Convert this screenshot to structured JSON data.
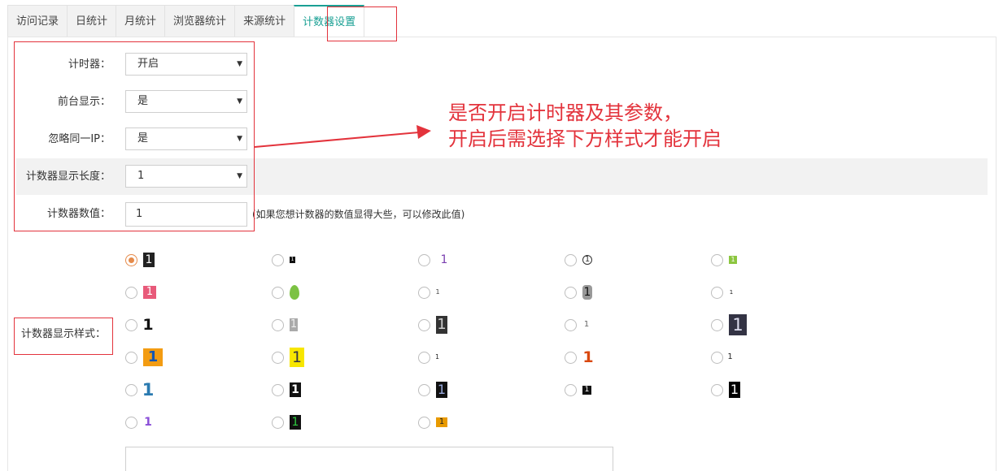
{
  "tabs": [
    {
      "label": "访问记录",
      "active": false
    },
    {
      "label": "日统计",
      "active": false
    },
    {
      "label": "月统计",
      "active": false
    },
    {
      "label": "浏览器统计",
      "active": false
    },
    {
      "label": "来源统计",
      "active": false
    },
    {
      "label": "计数器设置",
      "active": true
    }
  ],
  "form": {
    "timer": {
      "label": "计时器：",
      "value": "开启"
    },
    "front_display": {
      "label": "前台显示：",
      "value": "是"
    },
    "ignore_ip": {
      "label": "忽略同一IP：",
      "value": "是"
    },
    "display_length": {
      "label": "计数器显示长度：",
      "value": "1"
    },
    "counter_value": {
      "label": "计数器数值：",
      "value": "1",
      "hint": "(如果您想计数器的数值显得大些，可以修改此值)"
    },
    "style_label": "计数器显示样式："
  },
  "annotation": {
    "line1": "是否开启计时器及其参数，",
    "line2": "开启后需选择下方样式才能开启"
  },
  "styles": {
    "selected_index": 0,
    "count": 28,
    "glyph": "1"
  },
  "colors": {
    "accent": "#1aa094",
    "annotation": "#e3333c",
    "radio_checked": "#e58a4a"
  }
}
